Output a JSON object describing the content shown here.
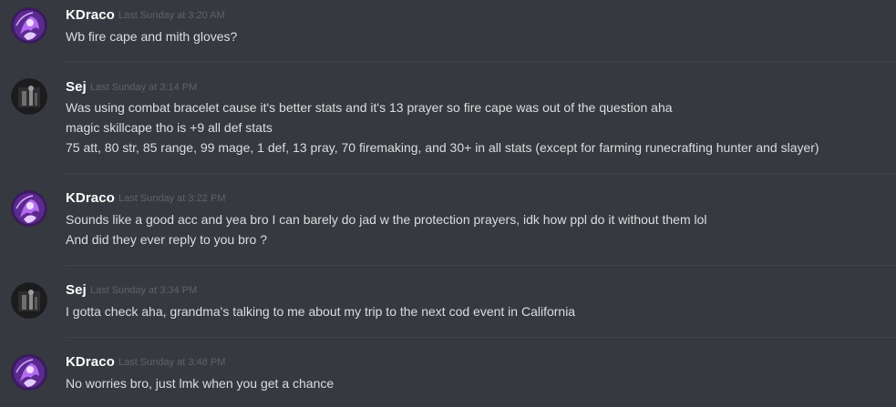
{
  "messages": [
    {
      "username": "KDraco",
      "timestamp": "Last Sunday at 3:20 AM",
      "avatar": "purple-character-avatar",
      "lines": [
        "Wb fire cape and mith gloves?"
      ]
    },
    {
      "username": "Sej",
      "timestamp": "Last Sunday at 3:14 PM",
      "avatar": "dark-photo-avatar",
      "lines": [
        "Was using combat bracelet cause it's better stats and it's 13 prayer so fire cape was out of the question aha",
        "magic skillcape tho is +9 all def stats",
        "75 att, 80 str, 85 range, 99 mage, 1 def, 13 pray, 70 firemaking, and 30+ in all stats (except for farming runecrafting hunter and slayer)"
      ]
    },
    {
      "username": "KDraco",
      "timestamp": "Last Sunday at 3:22 PM",
      "avatar": "purple-character-avatar",
      "lines": [
        "Sounds like a good acc and yea bro I can barely do jad w the protection prayers, idk how ppl do it without them lol",
        "And did they ever reply to you bro ?"
      ]
    },
    {
      "username": "Sej",
      "timestamp": "Last Sunday at 3:34 PM",
      "avatar": "dark-photo-avatar",
      "lines": [
        "I gotta check aha, grandma's talking to me about my trip to the next cod event in California"
      ]
    },
    {
      "username": "KDraco",
      "timestamp": "Last Sunday at 3:48 PM",
      "avatar": "purple-character-avatar",
      "lines": [
        "No worries bro, just lmk when you get a chance"
      ]
    }
  ],
  "colors": {
    "background": "#36393f",
    "username": "#ffffff",
    "timestamp": "#5f636a",
    "message_text": "#dcddde",
    "divider": "#41444a"
  }
}
